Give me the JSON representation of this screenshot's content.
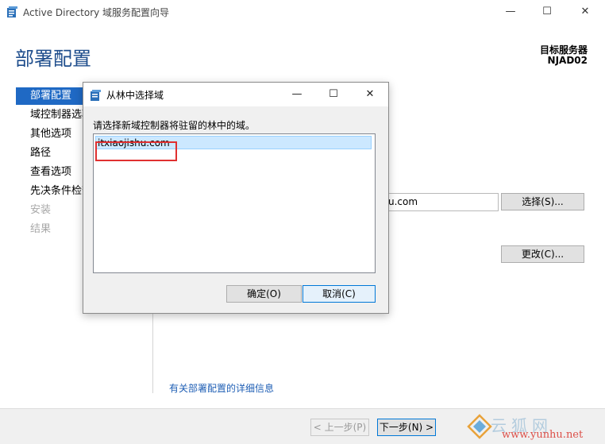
{
  "window": {
    "title": "Active Directory 域服务配置向导",
    "minimize": "—",
    "maximize": "☐",
    "close": "✕"
  },
  "page": {
    "title": "部署配置",
    "target_label": "目标服务器",
    "target_server": "NJAD02"
  },
  "nav": {
    "items": [
      {
        "label": "部署配置",
        "state": "active"
      },
      {
        "label": "域控制器选项",
        "state": "normal"
      },
      {
        "label": "其他选项",
        "state": "normal"
      },
      {
        "label": "路径",
        "state": "normal"
      },
      {
        "label": "查看选项",
        "state": "normal"
      },
      {
        "label": "先决条件检查",
        "state": "normal"
      },
      {
        "label": "安装",
        "state": "disabled"
      },
      {
        "label": "结果",
        "state": "disabled"
      }
    ]
  },
  "main": {
    "domain_value_partial": "u.com",
    "select_button": "选择(S)...",
    "change_button": "更改(C)...",
    "info_link": "有关部署配置的详细信息"
  },
  "footer": {
    "prev_button": "< 上一步(P)",
    "next_button": "下一步(N) >"
  },
  "watermark": {
    "brand": "云狐网",
    "url": "www.yunhu.net"
  },
  "dialog": {
    "title": "从林中选择域",
    "minimize": "—",
    "maximize": "☐",
    "close": "✕",
    "prompt": "请选择新域控制器将驻留的林中的域。",
    "domains": [
      "itxiaojishu.com"
    ],
    "ok_button": "确定(O)",
    "cancel_button": "取消(C)"
  },
  "colors": {
    "accent": "#1f69c4",
    "title_blue": "#1e4d8c",
    "highlight_box": "#e03030",
    "selection": "#cce8ff"
  }
}
